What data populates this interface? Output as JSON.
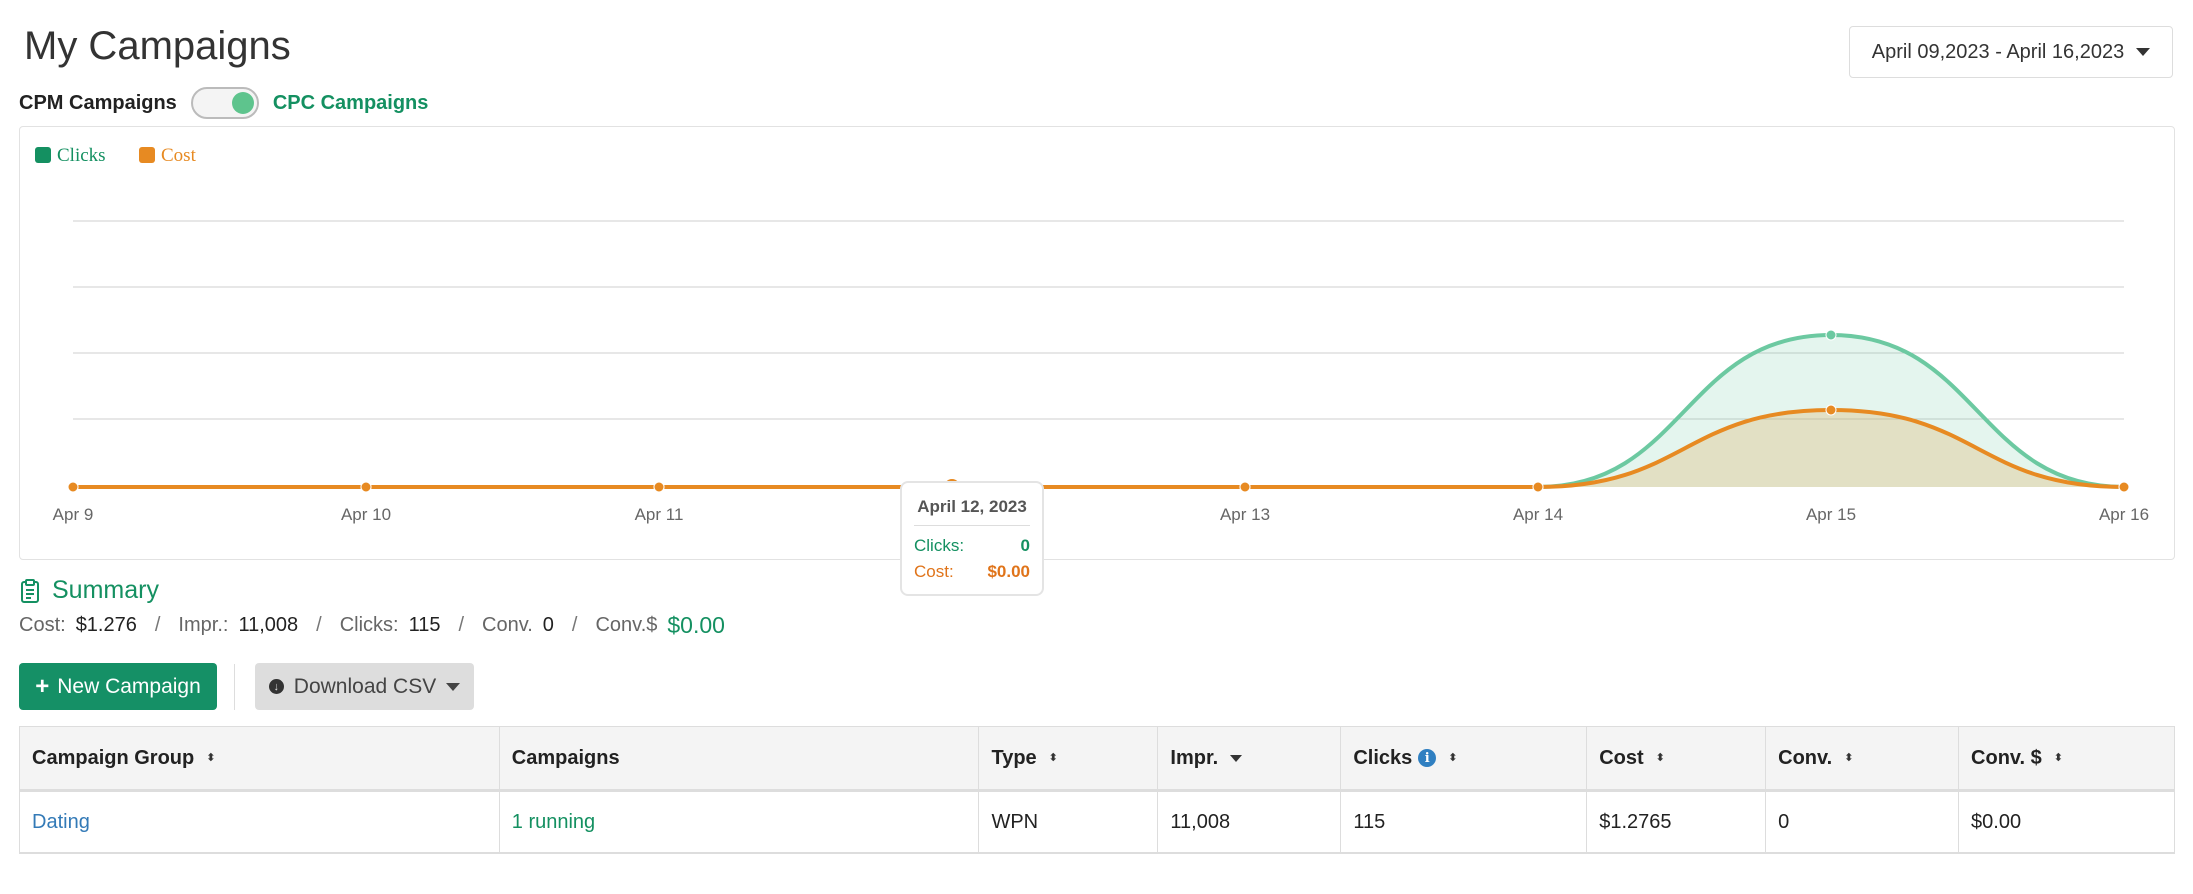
{
  "page": {
    "title": "My Campaigns"
  },
  "date_range": {
    "label": "April 09,2023 - April 16,2023"
  },
  "toggle": {
    "left_label": "CPM Campaigns",
    "right_label": "CPC Campaigns",
    "state": "CPC"
  },
  "colors": {
    "accent": "#149061",
    "clicks": "#6cc9a1",
    "cost": "#e78a22",
    "link": "#337ab7"
  },
  "chart_data": {
    "type": "area",
    "x": [
      "Apr 9",
      "Apr 10",
      "Apr 11",
      "Apr 12",
      "Apr 13",
      "Apr 14",
      "Apr 15",
      "Apr 16"
    ],
    "series": [
      {
        "name": "Clicks",
        "values": [
          0,
          0,
          0,
          0,
          0,
          0,
          115,
          0
        ],
        "color": "#6cc9a1"
      },
      {
        "name": "Cost",
        "values": [
          0,
          0,
          0,
          0,
          0,
          0,
          1.2765,
          0
        ],
        "color": "#e78a22"
      }
    ],
    "grid": true,
    "legend_position": "top-left",
    "highlighted_index": 3,
    "tooltip": {
      "date": "April 12, 2023",
      "clicks_label": "Clicks:",
      "clicks_value": "0",
      "cost_label": "Cost:",
      "cost_value": "$0.00"
    }
  },
  "summary": {
    "title": "Summary",
    "cost_label": "Cost:",
    "cost_value": "$1.276",
    "impr_label": "Impr.:",
    "impr_value": "11,008",
    "clicks_label": "Clicks:",
    "clicks_value": "115",
    "conv_label": "Conv.",
    "conv_value": "0",
    "convd_label": "Conv.$",
    "convd_value": "$0.00",
    "separator": "/"
  },
  "buttons": {
    "new_campaign": "New Campaign",
    "download_csv": "Download CSV"
  },
  "table": {
    "headers": [
      "Campaign Group",
      "Campaigns",
      "Type",
      "Impr.",
      "Clicks",
      "Cost",
      "Conv.",
      "Conv. $"
    ],
    "rows": [
      [
        "Dating",
        "1 running",
        "WPN",
        "11,008",
        "115",
        "$1.2765",
        "0",
        "$0.00"
      ]
    ]
  }
}
